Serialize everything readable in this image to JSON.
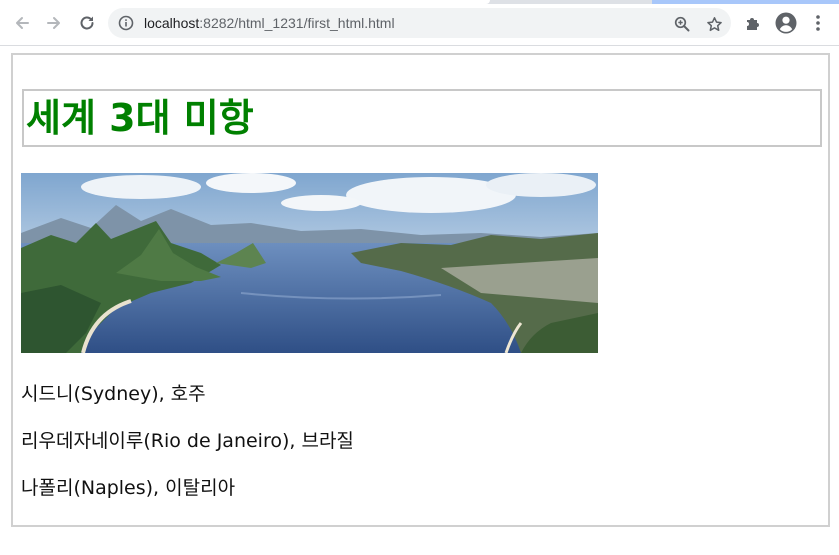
{
  "browser": {
    "url_host": "localhost",
    "url_path": ":8282/html_1231/first_html.html",
    "icons": {
      "back": "back-arrow-icon",
      "forward": "forward-arrow-icon",
      "reload": "reload-icon",
      "site_info": "info-icon",
      "zoom": "zoom-icon",
      "bookmark": "star-icon",
      "extensions": "puzzle-icon",
      "profile": "account-icon",
      "menu": "kebab-menu-icon"
    }
  },
  "page": {
    "heading": "세계 3대 미항",
    "heading_color": "#008000",
    "cities": [
      "시드니(Sydney), 호주",
      "리우데자네이루(Rio de Janeiro), 브라질",
      "나폴리(Naples), 이탈리아"
    ]
  }
}
